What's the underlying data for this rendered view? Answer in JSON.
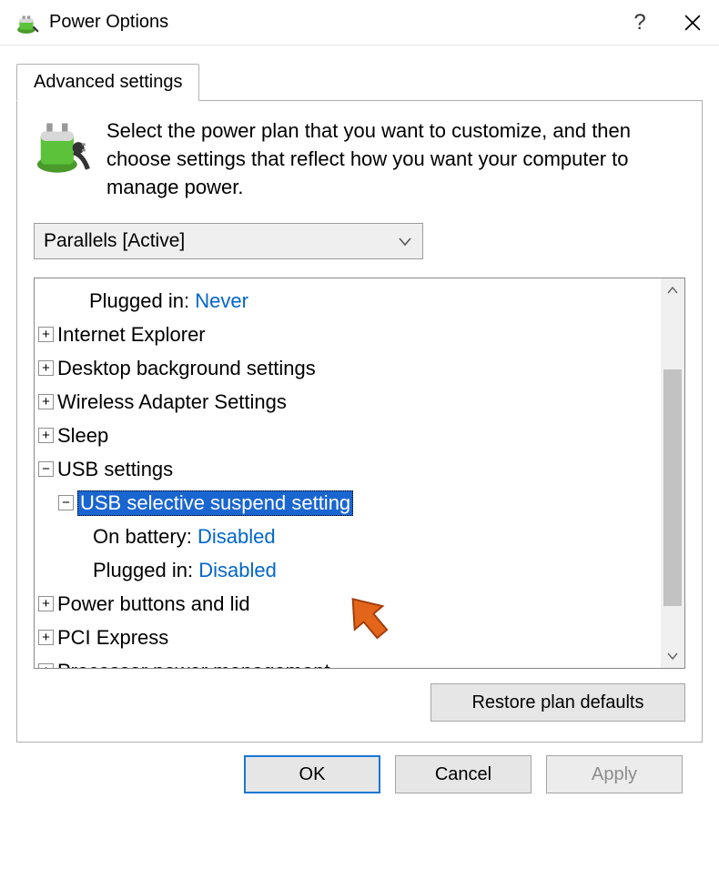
{
  "window": {
    "title": "Power Options",
    "help_tooltip": "?",
    "close_tooltip": "Close"
  },
  "tab": {
    "label": "Advanced settings"
  },
  "intro": "Select the power plan that you want to customize, and then choose settings that reflect how you want your computer to manage power.",
  "plan_select": {
    "value": "Parallels [Active]"
  },
  "tree": {
    "r0": {
      "lbl": "Plugged in:",
      "val": "Never"
    },
    "r1": {
      "lbl": "Internet Explorer"
    },
    "r2": {
      "lbl": "Desktop background settings"
    },
    "r3": {
      "lbl": "Wireless Adapter Settings"
    },
    "r4": {
      "lbl": "Sleep"
    },
    "r5": {
      "lbl": "USB settings"
    },
    "r6": {
      "lbl": "USB selective suspend setting"
    },
    "r7": {
      "lbl": "On battery:",
      "val": "Disabled"
    },
    "r8": {
      "lbl": "Plugged in:",
      "val": "Disabled"
    },
    "r9": {
      "lbl": "Power buttons and lid"
    },
    "r10": {
      "lbl": "PCI Express"
    },
    "r11": {
      "lbl": "Processor power management"
    }
  },
  "buttons": {
    "restore": "Restore plan defaults",
    "ok": "OK",
    "cancel": "Cancel",
    "apply": "Apply"
  },
  "exp": {
    "plus": "+",
    "minus": "−"
  }
}
